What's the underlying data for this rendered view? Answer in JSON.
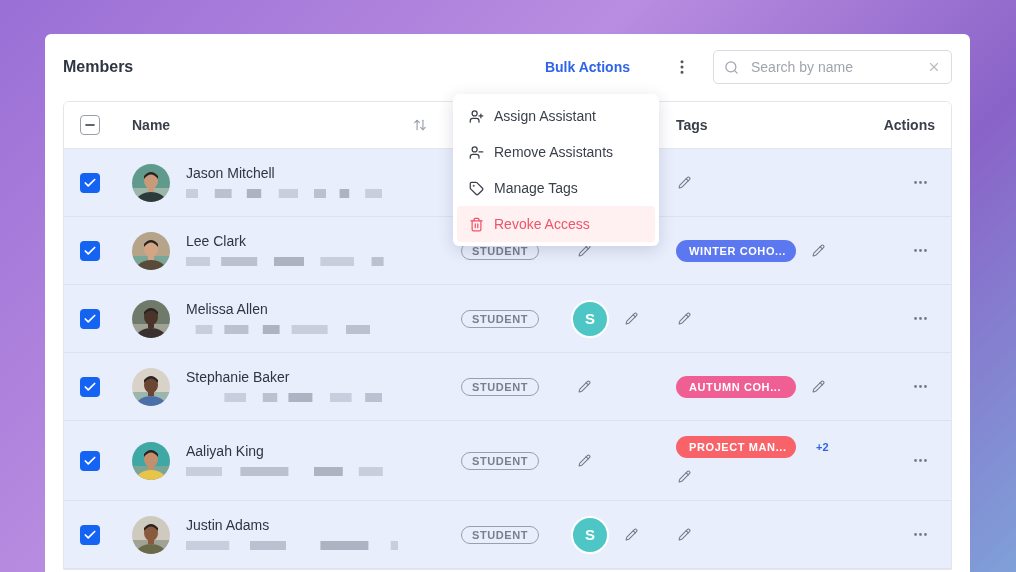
{
  "card": {
    "title": "Members",
    "bulk_actions": "Bulk Actions",
    "search": {
      "placeholder": "Search by name"
    }
  },
  "table": {
    "header_checkbox": {
      "indeterminate": true
    },
    "columns": [
      {
        "label": "Name"
      },
      {
        "label": "Tags"
      },
      {
        "label": "Actions"
      }
    ],
    "rows": [
      {
        "name": "Jason Mitchell",
        "checked": true,
        "avatar": {
          "kind": "picture"
        },
        "tags": []
      },
      {
        "name": "Lee Clark",
        "checked": true,
        "avatar": {
          "kind": "picture"
        },
        "role": "STUDENT",
        "assistants": [],
        "tags": [
          {
            "label": "WINTER COHO...",
            "color": "#5b78f0"
          }
        ]
      },
      {
        "name": "Melissa Allen",
        "checked": true,
        "avatar": {
          "kind": "picture"
        },
        "role": "STUDENT",
        "assistants": [
          {
            "initial": "S",
            "color": "#4fc6c6"
          }
        ],
        "tags": []
      },
      {
        "name": "Stephanie Baker",
        "checked": true,
        "avatar": {
          "kind": "picture"
        },
        "role": "STUDENT",
        "assistants": [],
        "tags": [
          {
            "label": "AUTUMN COH...",
            "color": "#ef5f94"
          }
        ]
      },
      {
        "name": "Aaliyah King",
        "checked": true,
        "avatar": {
          "kind": "picture"
        },
        "role": "STUDENT",
        "assistants": [],
        "tags": [
          {
            "label": "PROJECT MAN...",
            "color": "#f8636a"
          }
        ],
        "more_tags": "+2"
      },
      {
        "name": "Justin Adams",
        "checked": true,
        "avatar": {
          "kind": "picture"
        },
        "role": "STUDENT",
        "assistants": [
          {
            "initial": "S",
            "color": "#4fc6c6"
          }
        ],
        "tags": []
      }
    ]
  },
  "menu": {
    "items": [
      {
        "label": "Assign Assistant",
        "kind": "assign",
        "highlighted": false
      },
      {
        "label": "Remove Assistants",
        "kind": "remove",
        "highlighted": false
      },
      {
        "label": "Manage Tags",
        "kind": "tags",
        "highlighted": false
      },
      {
        "label": "Revoke Access",
        "kind": "revoke",
        "highlighted": true
      }
    ]
  }
}
